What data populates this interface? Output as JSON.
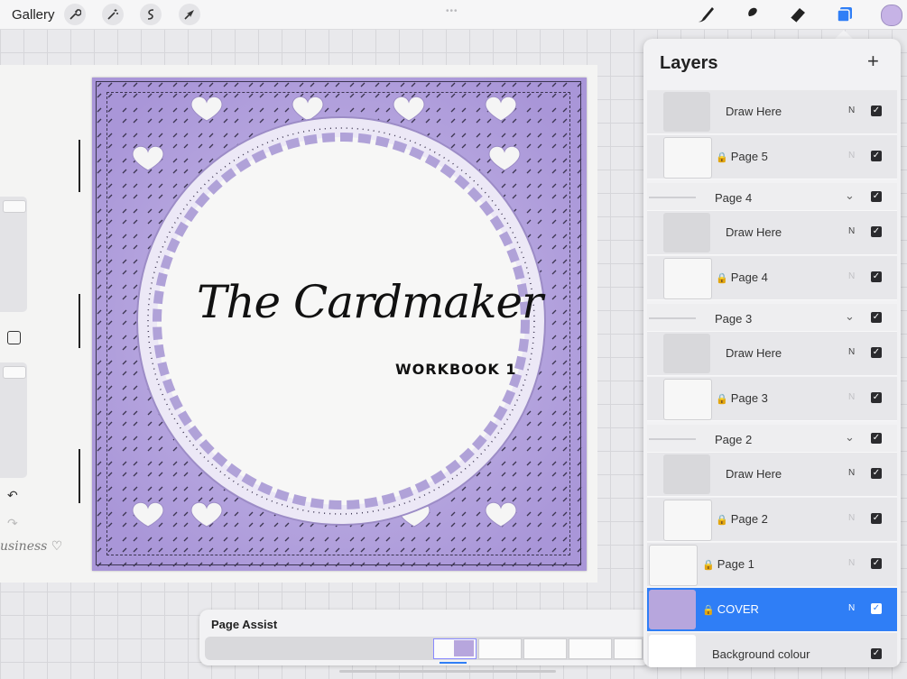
{
  "topbar": {
    "gallery_label": "Gallery",
    "left_tools": [
      "wrench-icon",
      "magic-wand-icon",
      "selection-icon",
      "transform-arrow-icon"
    ],
    "right_tools": [
      "brush-icon",
      "smudge-icon",
      "eraser-icon",
      "layers-icon"
    ],
    "color": "#c6b3e6",
    "grabber": "•••"
  },
  "canvas": {
    "title": "The Cardmaker",
    "subtitle": "WORKBOOK 1",
    "side_script": "usiness ♡",
    "card_color": "#b7a6dd"
  },
  "sidebar": {
    "undo": "↶",
    "redo": "↷"
  },
  "page_assist": {
    "title": "Page Assist"
  },
  "layers": {
    "title": "Layers",
    "add": "+",
    "rows": [
      {
        "type": "layer",
        "name": "Draw Here",
        "blend": "N"
      },
      {
        "type": "layer",
        "name": "Page 5",
        "blend": "N"
      },
      {
        "type": "group",
        "name": "Page 4"
      },
      {
        "type": "layer",
        "name": "Draw Here",
        "blend": "N"
      },
      {
        "type": "layer",
        "name": "Page 4",
        "blend": "N"
      },
      {
        "type": "group",
        "name": "Page 3"
      },
      {
        "type": "layer",
        "name": "Draw Here",
        "blend": "N"
      },
      {
        "type": "layer",
        "name": "Page 3",
        "blend": "N"
      },
      {
        "type": "group",
        "name": "Page 2"
      },
      {
        "type": "layer",
        "name": "Draw Here",
        "blend": "N"
      },
      {
        "type": "layer",
        "name": "Page 2",
        "blend": "N"
      },
      {
        "type": "layer",
        "name": "Page 1",
        "blend": "N"
      },
      {
        "type": "layer",
        "name": "COVER",
        "blend": "N",
        "selected": true
      },
      {
        "type": "layer",
        "name": "Background colour"
      }
    ]
  }
}
